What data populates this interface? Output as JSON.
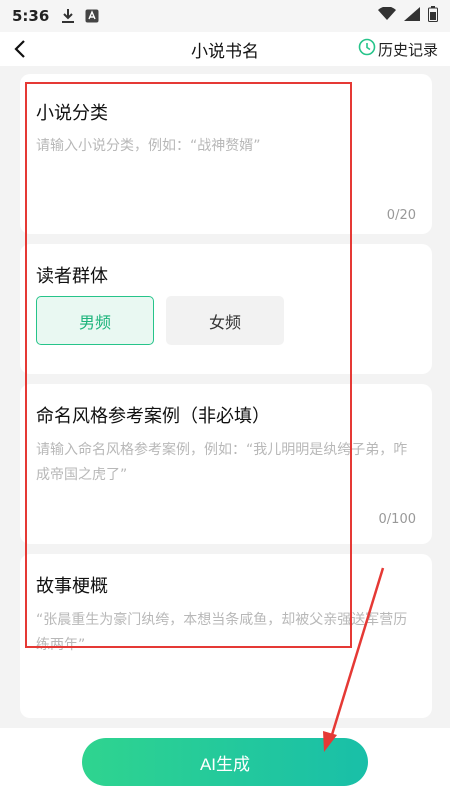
{
  "status_bar": {
    "time": "5:36"
  },
  "nav": {
    "title": "小说书名",
    "history_label": "历史记录"
  },
  "cards": {
    "genre": {
      "title": "小说分类",
      "placeholder": "请输入小说分类，例如：“战神赘婿”",
      "counter": "0/20"
    },
    "audience": {
      "title": "读者群体",
      "options": [
        "男频",
        "女频"
      ],
      "selected": "男频"
    },
    "style": {
      "title": "命名风格参考案例（非必填）",
      "placeholder": "请输入命名风格参考案例，例如：“我儿明明是纨绔子弟，咋成帝国之虎了”",
      "counter": "0/100"
    },
    "synopsis": {
      "title": "故事梗概",
      "placeholder": "“张晨重生为豪门纨绔，本想当条咸鱼，却被父亲强送军营历练两年”"
    }
  },
  "footer": {
    "button_label": "AI生成"
  },
  "colors": {
    "accent": "#26c48a",
    "annotation": "#e53935"
  }
}
